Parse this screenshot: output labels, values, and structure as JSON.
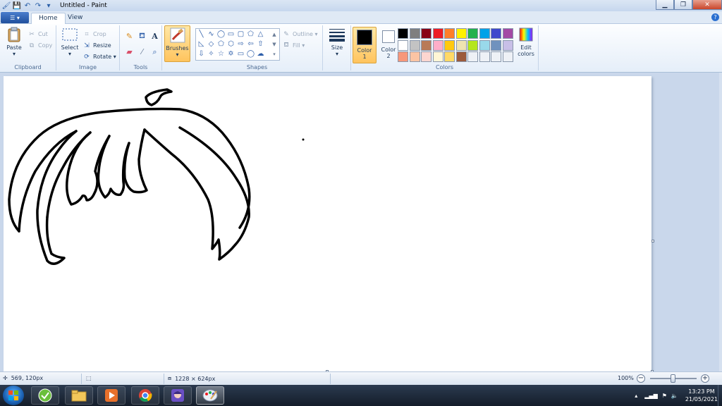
{
  "window": {
    "title": "Untitled - Paint"
  },
  "tabs": [
    {
      "label": "Home"
    },
    {
      "label": "View"
    }
  ],
  "ribbon": {
    "clipboard": {
      "label": "Clipboard",
      "paste": "Paste",
      "cut": "Cut",
      "copy": "Copy"
    },
    "image": {
      "label": "Image",
      "select": "Select",
      "crop": "Crop",
      "resize": "Resize",
      "rotate": "Rotate"
    },
    "tools": {
      "label": "Tools",
      "brushes": "Brushes"
    },
    "shapes": {
      "label": "Shapes",
      "outline": "Outline",
      "fill": "Fill"
    },
    "size": {
      "label": "Size"
    },
    "colors": {
      "label": "Colors",
      "color1_label": "Color 1",
      "color2_label": "Color 2",
      "color1": "#000000",
      "color2": "#ffffff",
      "edit_colors": "Edit colors",
      "palette": [
        "#000000",
        "#7f7f7f",
        "#880015",
        "#ed1c24",
        "#ff7f27",
        "#fff200",
        "#22b14c",
        "#00a2e8",
        "#3f48cc",
        "#a349a4",
        "#ffffff",
        "#c3c3c3",
        "#b97a57",
        "#ffaec9",
        "#ffc90e",
        "#efe4b0",
        "#b5e61d",
        "#99d9ea",
        "#7092be",
        "#c8bfe7",
        "#f7977a",
        "#fbc4a4",
        "#fdd6d0",
        "#fff6d5",
        "#ffd966",
        "#9c5a3c",
        "#eef1f6",
        "#eef1f6",
        "#eef1f6",
        "#eef1f6"
      ]
    }
  },
  "status": {
    "cursor_pos": "569, 120px",
    "image_size": "1228 × 624px",
    "zoom": "100%"
  },
  "taskbar": {
    "time": "13:23 PM",
    "date": "21/05/2021"
  }
}
